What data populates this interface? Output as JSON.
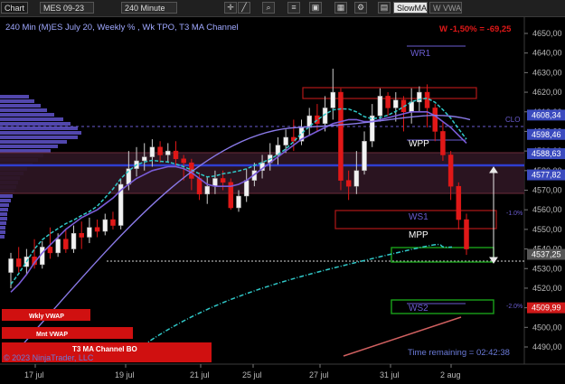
{
  "toolbar": {
    "chart_label": "Chart",
    "instrument": "MES 09-23",
    "interval": "240 Minute",
    "active_indicator": "SlowMA",
    "inactive_indicator": "W VWAP"
  },
  "chart": {
    "title": "240 Min (M)ES July 20, Weekly % , Wk TPO, T3 MA Channel",
    "change_text": "W -1,50% = -69,25",
    "copyright": "© 2023 NinjaTrader, LLC",
    "time_remaining": "Time remaining = 02:42:38",
    "badges": [
      "Wkly VWAP",
      "Mnt VWAP",
      "T3 MA Channel BO"
    ]
  },
  "levels": {
    "wr1": "WR1",
    "wpp": "WPP",
    "ws1": "WS1",
    "mpp": "MPP",
    "ws2": "WS2",
    "clo": "CLO",
    "pct_minus_1": "-1.0%",
    "pct_minus_2": "-2.0%"
  },
  "price_axis": {
    "ticks": [
      "4650,00",
      "4640,00",
      "4630,00",
      "4620,00",
      "4610,00",
      "4600,00",
      "4590,00",
      "4580,00",
      "4570,00",
      "4560,00",
      "4550,00",
      "4540,00",
      "4530,00",
      "4520,00",
      "4510,00",
      "4500,00",
      "4490,00"
    ],
    "price_labels": [
      {
        "text": "4608,34",
        "color": "#3b4bbf"
      },
      {
        "text": "4598,46",
        "color": "#3b4bbf"
      },
      {
        "text": "4588,63",
        "color": "#3b4bbf"
      },
      {
        "text": "4577,82",
        "color": "#3b4bbf"
      },
      {
        "text": "4537,25",
        "color": "#555555"
      },
      {
        "text": "4509,99",
        "color": "#d01a1a"
      }
    ]
  },
  "time_axis": {
    "labels": [
      "17 jul",
      "19 jul",
      "21 jul",
      "25 jul",
      "27 jul",
      "31 jul",
      "2 aug"
    ]
  },
  "chart_data": {
    "type": "candlestick",
    "ylim": [
      4485,
      4655
    ],
    "candles": [
      [
        4528,
        4535,
        4520,
        4538
      ],
      [
        4535,
        4531,
        4528,
        4541
      ],
      [
        4531,
        4536,
        4527,
        4540
      ],
      [
        4536,
        4532,
        4530,
        4545
      ],
      [
        4532,
        4541,
        4530,
        4544
      ],
      [
        4541,
        4538,
        4535,
        4551
      ],
      [
        4538,
        4545,
        4536,
        4548
      ],
      [
        4545,
        4540,
        4538,
        4550
      ],
      [
        4540,
        4548,
        4538,
        4552
      ],
      [
        4548,
        4546,
        4540,
        4554
      ],
      [
        4546,
        4551,
        4543,
        4556
      ],
      [
        4551,
        4549,
        4546,
        4555
      ],
      [
        4549,
        4555,
        4547,
        4558
      ],
      [
        4555,
        4552,
        4550,
        4559
      ],
      [
        4552,
        4573,
        4550,
        4576
      ],
      [
        4573,
        4581,
        4570,
        4590
      ],
      [
        4581,
        4585,
        4577,
        4592
      ],
      [
        4585,
        4587,
        4580,
        4594
      ],
      [
        4587,
        4592,
        4582,
        4596
      ],
      [
        4592,
        4588,
        4584,
        4595
      ],
      [
        4588,
        4590,
        4584,
        4594
      ],
      [
        4590,
        4586,
        4582,
        4595
      ],
      [
        4586,
        4584,
        4575,
        4588
      ],
      [
        4584,
        4576,
        4570,
        4586
      ],
      [
        4576,
        4568,
        4565,
        4579
      ],
      [
        4568,
        4572,
        4563,
        4577
      ],
      [
        4572,
        4576,
        4568,
        4580
      ],
      [
        4576,
        4574,
        4570,
        4580
      ],
      [
        4574,
        4561,
        4560,
        4576
      ],
      [
        4561,
        4567,
        4559,
        4570
      ],
      [
        4567,
        4575,
        4564,
        4581
      ],
      [
        4575,
        4580,
        4572,
        4584
      ],
      [
        4580,
        4584,
        4576,
        4588
      ],
      [
        4584,
        4588,
        4580,
        4594
      ],
      [
        4588,
        4593,
        4583,
        4597
      ],
      [
        4593,
        4597,
        4589,
        4601
      ],
      [
        4597,
        4595,
        4590,
        4606
      ],
      [
        4595,
        4602,
        4593,
        4606
      ],
      [
        4602,
        4608,
        4598,
        4612
      ],
      [
        4608,
        4604,
        4600,
        4614
      ],
      [
        4604,
        4612,
        4600,
        4618
      ],
      [
        4612,
        4620,
        4606,
        4632
      ],
      [
        4620,
        4575,
        4570,
        4622
      ],
      [
        4575,
        4572,
        4565,
        4580
      ],
      [
        4572,
        4580,
        4568,
        4590
      ],
      [
        4580,
        4595,
        4578,
        4600
      ],
      [
        4595,
        4608,
        4592,
        4614
      ],
      [
        4608,
        4618,
        4605,
        4622
      ],
      [
        4618,
        4612,
        4608,
        4620
      ],
      [
        4612,
        4616,
        4605,
        4620
      ],
      [
        4616,
        4610,
        4600,
        4618
      ],
      [
        4610,
        4615,
        4604,
        4622
      ],
      [
        4615,
        4620,
        4610,
        4623
      ],
      [
        4620,
        4612,
        4602,
        4624
      ],
      [
        4612,
        4600,
        4595,
        4614
      ],
      [
        4600,
        4588,
        4585,
        4605
      ],
      [
        4588,
        4572,
        4565,
        4590
      ],
      [
        4572,
        4555,
        4550,
        4574
      ],
      [
        4555,
        4540,
        4537,
        4558
      ]
    ],
    "series": [
      {
        "name": "T3 MA Channel",
        "values": [
          4518,
          4522,
          4527,
          4533,
          4538,
          4542,
          4546,
          4550,
          4553,
          4556,
          4558,
          4560,
          4563,
          4566,
          4570,
          4573,
          4576,
          4578,
          4580,
          4581,
          4582,
          4582,
          4581,
          4579,
          4576,
          4573,
          4572,
          4572,
          4572,
          4573,
          4575,
          4578,
          4581,
          4584,
          4587,
          4590,
          4593,
          4596,
          4598,
          4600,
          4602,
          4604,
          4605,
          4606,
          4606,
          4605,
          4605,
          4606,
          4607,
          4608,
          4609,
          4610,
          4610,
          4610,
          4608,
          4605,
          4602,
          4598,
          4594
        ]
      }
    ]
  }
}
